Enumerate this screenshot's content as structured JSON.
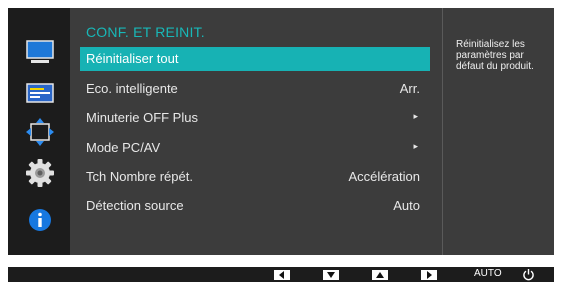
{
  "menu": {
    "title": "CONF. ET REINIT.",
    "items": [
      {
        "label": "Réinitialiser tout",
        "value": "",
        "selected": true
      },
      {
        "label": "Eco. intelligente",
        "value": "Arr."
      },
      {
        "label": "Minuterie OFF Plus",
        "value": "",
        "arrow": "▸"
      },
      {
        "label": "Mode PC/AV",
        "value": "",
        "arrow": "▸"
      },
      {
        "label": "Tch Nombre répét.",
        "value": "Accélération"
      },
      {
        "label": "Détection source",
        "value": "Auto"
      }
    ]
  },
  "help": {
    "text": "Réinitialisez les paramètres par défaut du produit."
  },
  "sidebar": {
    "icons": [
      "monitor-icon",
      "screen-icon",
      "size-position-icon",
      "gear-icon",
      "info-icon"
    ]
  },
  "bottom_bar": {
    "buttons": [
      "left-arrow-icon",
      "down-arrow-icon",
      "up-arrow-icon",
      "right-arrow-icon"
    ],
    "auto_label": "AUTO"
  },
  "colors": {
    "accent": "#17b2b4",
    "panel": "#3c3c3c",
    "background": "#1c1c1c"
  }
}
